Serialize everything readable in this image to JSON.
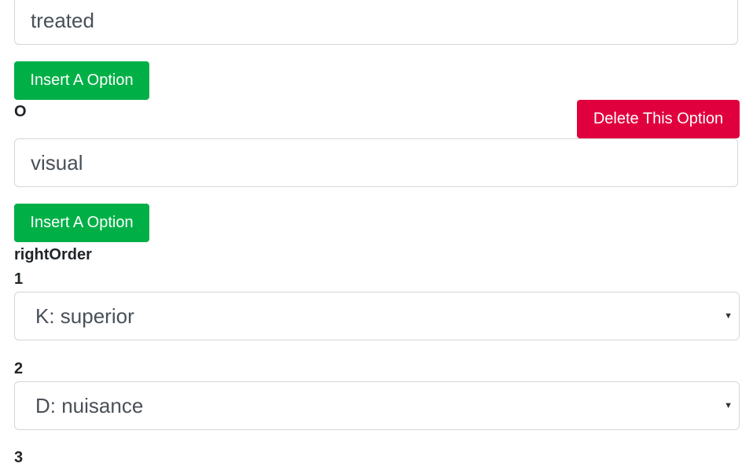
{
  "fields": [
    {
      "value": "treated"
    },
    {
      "value": "visual"
    }
  ],
  "buttons": {
    "insert_label": "Insert A Option",
    "delete_label": "Delete This Option"
  },
  "option_label": "O",
  "right_order": {
    "heading": "rightOrder",
    "items": [
      {
        "number": "1",
        "selected": "K: superior"
      },
      {
        "number": "2",
        "selected": "D: nuisance"
      },
      {
        "number": "3"
      }
    ]
  },
  "colors": {
    "insert_button": "#00b047",
    "delete_button": "#e1003e",
    "input_border": "#d3d7db"
  },
  "icons": {
    "select_caret": "caret-down-icon"
  }
}
